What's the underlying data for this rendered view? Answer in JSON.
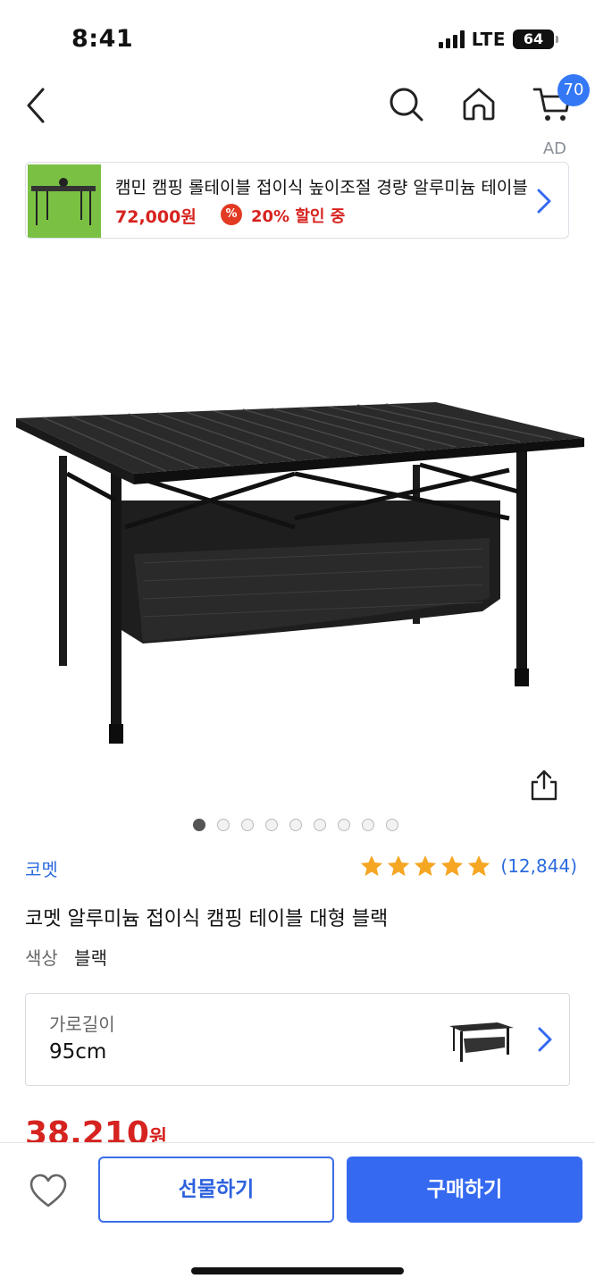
{
  "status_bar": {
    "time": "8:41",
    "network": "LTE",
    "battery": "64"
  },
  "nav": {
    "cart_count": "70",
    "icons": [
      "back-icon",
      "search-icon",
      "home-icon",
      "cart-icon"
    ]
  },
  "ad": {
    "label": "AD",
    "title": "캠민 캠핑 롤테이블 접이식 높이조절 경량 알루미늄 테이블",
    "price": "72,000원",
    "badge_icon": "%",
    "discount": "20% 할인 중"
  },
  "gallery": {
    "image_count": 9,
    "active_index": 0
  },
  "product": {
    "brand": "코멧",
    "rating_stars": 5,
    "rating_count": "(12,844)",
    "title": "코멧 알루미늄 접이식 캠핑 테이블 대형 블랙",
    "color_label": "색상",
    "color_value": "블랙"
  },
  "option": {
    "label": "가로길이",
    "value": "95cm"
  },
  "price": {
    "amount": "38,210",
    "unit": "원"
  },
  "actions": {
    "gift": "선물하기",
    "buy": "구매하기"
  },
  "colors": {
    "accent": "#3469f0",
    "price_red": "#d6231f",
    "link_blue": "#2d6bde",
    "star": "#f5a623"
  }
}
